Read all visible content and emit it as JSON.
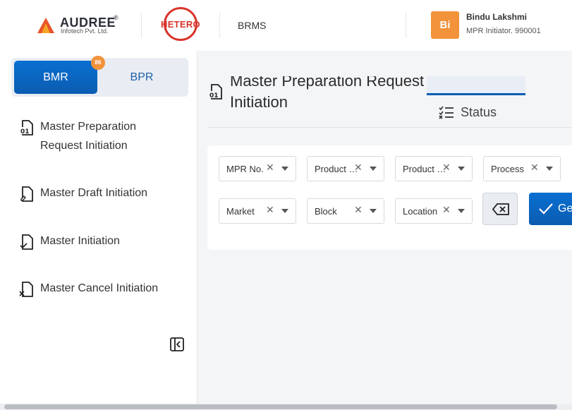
{
  "header": {
    "company_name": "AUDREE",
    "company_reg": "®",
    "company_sub": "Infotech Pvt. Ltd.",
    "client_logo_text": "HETERO",
    "app_name": "BRMS",
    "user": {
      "initials": "Bi",
      "name": "Bindu Lakshmi",
      "role": "MPR Initiator. 990001"
    }
  },
  "sidebar": {
    "toggle": {
      "left": "BMR",
      "right": "BPR",
      "active": "BMR"
    },
    "badge": "86",
    "items": [
      {
        "label": "Master Preparation Request Initiation",
        "icon": "document-01-icon"
      },
      {
        "label": "Master Draft Initiation",
        "icon": "document-edit-icon"
      },
      {
        "label": "Master Initiation",
        "icon": "document-check-icon"
      },
      {
        "label": "Master Cancel Initiation",
        "icon": "document-cancel-icon"
      }
    ]
  },
  "main": {
    "title": "Master Preparation Request Initiation",
    "status_tab": "Status",
    "filters_row1": [
      "MPR No.",
      "Product Code",
      "Product Name",
      "Process"
    ],
    "filters_row2": [
      "Market",
      "Block",
      "Location"
    ],
    "go_label": "Get"
  },
  "colors": {
    "primary": "#0b5cb0",
    "accent_orange": "#f2923a",
    "hetero_red": "#d9342b"
  }
}
